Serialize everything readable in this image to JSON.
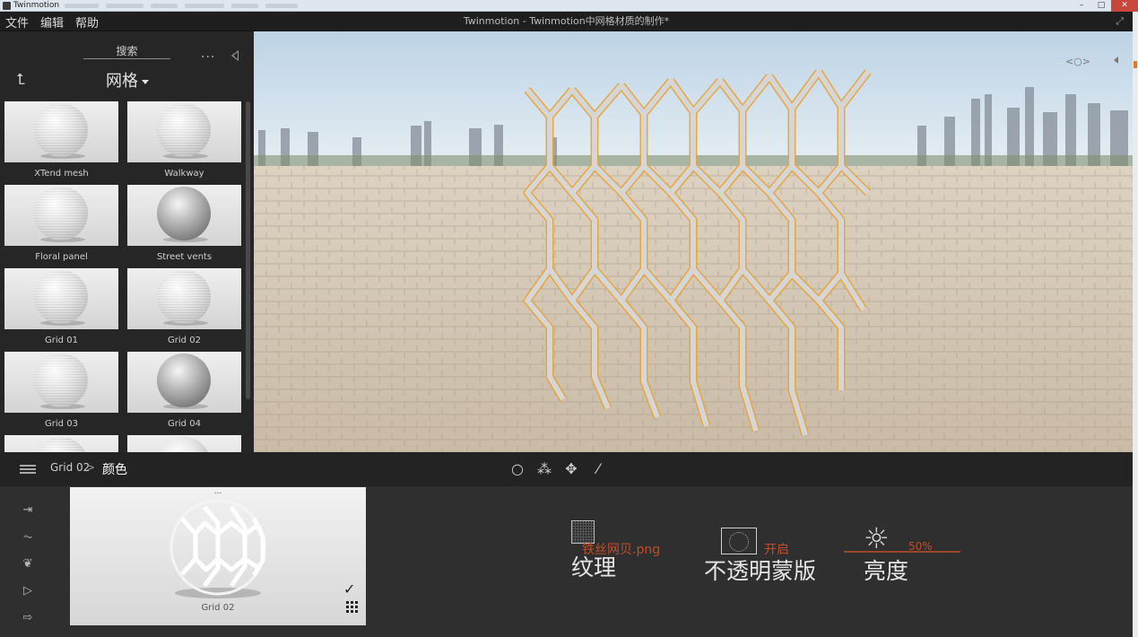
{
  "os_window": {
    "app_name": "Twinmotion",
    "buttons": [
      "–",
      "□",
      "✕"
    ]
  },
  "menubar": {
    "items": [
      "文件",
      "编辑",
      "帮助"
    ],
    "window_title": "Twinmotion - Twinmotion中网格材质的制作*",
    "expand_icon": "expand-icon"
  },
  "library": {
    "search_label": "搜索",
    "more_label": "...",
    "category": "网格",
    "items": [
      {
        "name": "XTend mesh"
      },
      {
        "name": "Walkway"
      },
      {
        "name": "Floral panel"
      },
      {
        "name": "Street vents"
      },
      {
        "name": "Grid 01"
      },
      {
        "name": "Grid 02"
      },
      {
        "name": "Grid 03"
      },
      {
        "name": "Grid 04"
      }
    ]
  },
  "toolbar": {
    "crumb_material": "Grid 02",
    "crumb_separator": ">",
    "crumb_section": "颜色",
    "tools": [
      "○",
      "⁂",
      "✥",
      "⁄"
    ]
  },
  "bottom": {
    "preview_dots": "...",
    "preview_name": "Grid 02",
    "properties": {
      "texture": {
        "label": "纹理",
        "value": "铁丝网贝.png"
      },
      "opacity_mask": {
        "label": "不透明蒙版",
        "value": "开启"
      },
      "brightness": {
        "label": "亮度",
        "value": "50%",
        "level": 0.5
      }
    }
  },
  "colors": {
    "accent": "#c04e2a",
    "mesh_outline": "#e7a53a",
    "panel_bg": "#262626"
  }
}
